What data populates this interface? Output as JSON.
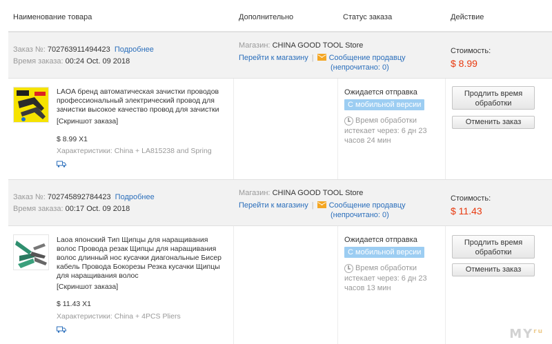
{
  "columns": {
    "product": "Наименование товара",
    "additional": "Дополнительно",
    "status": "Статус заказа",
    "action": "Действие"
  },
  "labels": {
    "order_no": "Заказ №:",
    "order_time": "Время заказа:",
    "details": "Подробнее",
    "store": "Магазин:",
    "go_store": "Перейти к магазину",
    "message": "Сообщение продавцу",
    "unread": "(непрочитано: 0)",
    "cost": "Стоимость:",
    "snapshot": "[Скриншот заказа]",
    "specs": "Характеристики:",
    "awaiting": "Ожидается отправка",
    "mobile": "С мобильной версии",
    "processing_time": "Время обработки",
    "extend": "Продлить время обработки",
    "cancel": "Отменить заказ"
  },
  "orders": [
    {
      "number": "702763911494423",
      "time": "00:24 Oct. 09 2018",
      "store": "CHINA GOOD TOOL Store",
      "cost": "$ 8.99",
      "product_title": "LAOA бренд автоматическая зачистки проводов профессиональный электрический провод для зачистки высокое качество провод для зачистки",
      "price": "$ 8.99 X1",
      "specs": "China + LA815238 and Spring",
      "expires": "истекает через: 6 дн 23 часов 24 мин",
      "thumb_icon": "wire-stripper-thumbnail"
    },
    {
      "number": "702745892784423",
      "time": "00:17 Oct. 09 2018",
      "store": "CHINA GOOD TOOL Store",
      "cost": "$ 11.43",
      "product_title": "Laoa японский Тип Щипцы для наращивания волос Провода резак Щипцы для наращивания волос длинный нос кусачки диагональные Бисер кабель Провода Бокорезы Резка кусачки Щипцы для наращивания волос",
      "price": "$ 11.43 X1",
      "specs": "China + 4PCS Pliers",
      "expires": "истекает через: 6 дн 23 часов 13 мин",
      "thumb_icon": "pliers-thumbnail"
    }
  ],
  "watermark": {
    "main": "MY",
    "sup": "ru"
  },
  "colors": {
    "link": "#2a6ebb",
    "price": "#e8380d",
    "badge": "#9ccdf2",
    "mail": "#f4a623"
  }
}
